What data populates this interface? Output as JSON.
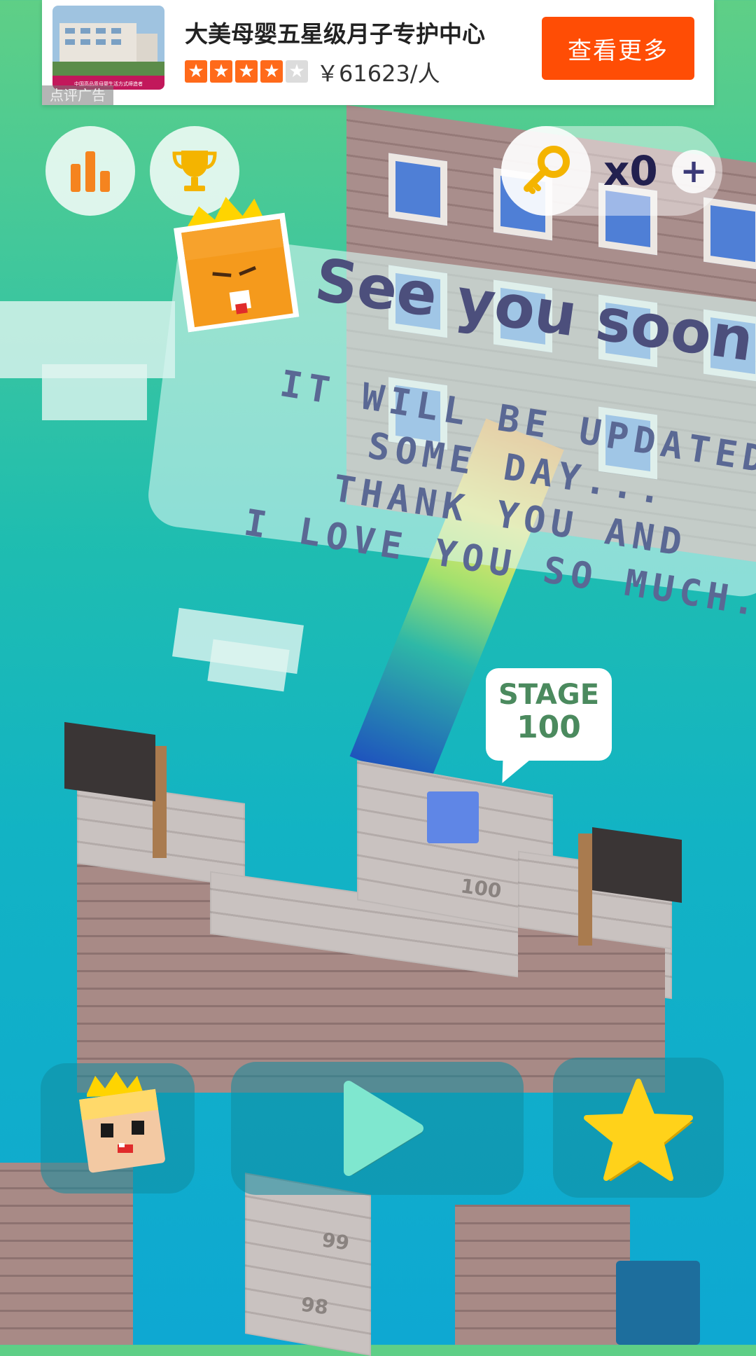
{
  "ad": {
    "title": "大美母婴五星级月子专护中心",
    "rating_stars": 4,
    "rating_max": 5,
    "price": "￥61623/人",
    "cta_label": "查看更多",
    "ad_label": "点评广告",
    "thumb_caption": "中国高品质母婴生活方式缔造者"
  },
  "hud": {
    "leaderboard_icon": "bar-chart-icon",
    "trophy_icon": "trophy-icon",
    "key_icon": "key-icon",
    "keys_count": "x0",
    "add_keys_label": "+"
  },
  "message": {
    "title": "See you soon.",
    "lines": [
      "IT WILL BE UPDATED",
      "SOME DAY...",
      "THANK YOU AND",
      "I LOVE YOU SO MUCH."
    ]
  },
  "stage": {
    "label": "STAGE",
    "number": "100",
    "tile_numbers": [
      "100",
      "99",
      "98"
    ]
  },
  "controls": {
    "character_icon": "king-character-icon",
    "play_icon": "play-icon",
    "star_icon": "star-icon"
  },
  "colors": {
    "accent_orange": "#ff4d05",
    "play_mint": "#7fe7cf",
    "star_yellow": "#ffd21a",
    "title_ink": "#4c4f7c"
  }
}
